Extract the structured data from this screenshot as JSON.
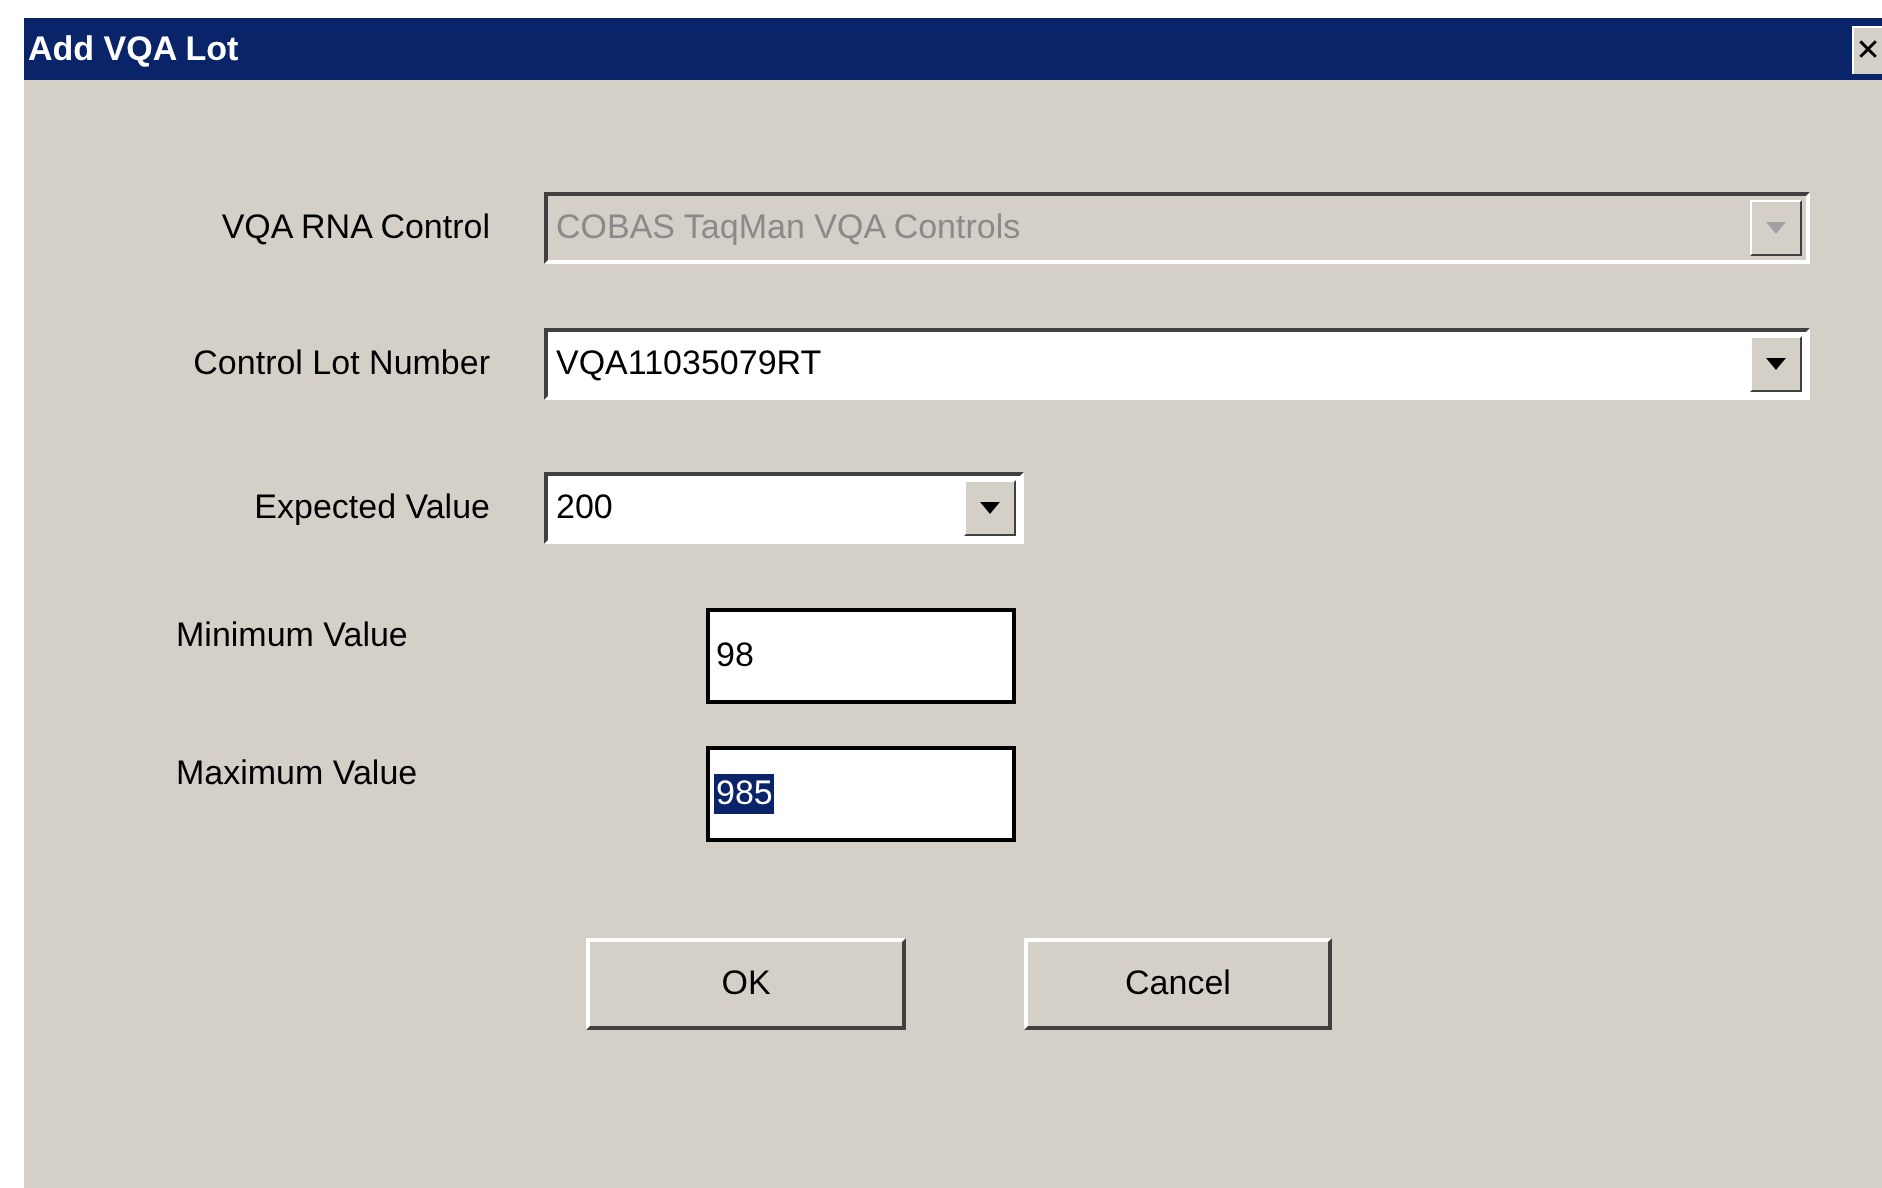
{
  "window": {
    "title": "Add VQA Lot",
    "close": "✕"
  },
  "fields": [
    {
      "kind": "dropdown",
      "label": "VQA RNA Control",
      "value": "COBAS TaqMan VQA Controls",
      "disabled": true,
      "selected": false
    },
    {
      "kind": "dropdown",
      "label": "Control Lot Number",
      "value": "VQA11035079RT",
      "disabled": false,
      "selected": false
    },
    {
      "kind": "short-dropdown",
      "label": "Expected Value",
      "value": "200",
      "disabled": false,
      "selected": false
    },
    {
      "kind": "text",
      "label": "Minimum Value",
      "value": "98",
      "disabled": false,
      "selected": false
    },
    {
      "kind": "text",
      "label": "Maximum Value",
      "value": "985",
      "disabled": false,
      "selected": true
    }
  ],
  "buttons": [
    "OK",
    "Cancel"
  ]
}
